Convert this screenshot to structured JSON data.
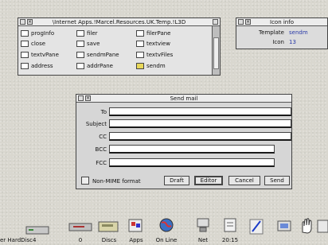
{
  "filer": {
    "title": "\\Internet Apps.!Marcel.Resources.UK.Temp.!L3D",
    "files": [
      {
        "name": "progInfo",
        "col": 0,
        "row": 0,
        "yellow": false
      },
      {
        "name": "close",
        "col": 0,
        "row": 1,
        "yellow": false
      },
      {
        "name": "textvPane",
        "col": 0,
        "row": 2,
        "yellow": false
      },
      {
        "name": "address",
        "col": 0,
        "row": 3,
        "yellow": false
      },
      {
        "name": "filer",
        "col": 1,
        "row": 0,
        "yellow": false
      },
      {
        "name": "save",
        "col": 1,
        "row": 1,
        "yellow": false
      },
      {
        "name": "sendmPane",
        "col": 1,
        "row": 2,
        "yellow": false
      },
      {
        "name": "addrPane",
        "col": 1,
        "row": 3,
        "yellow": false
      },
      {
        "name": "filerPane",
        "col": 2,
        "row": 0,
        "yellow": false
      },
      {
        "name": "textview",
        "col": 2,
        "row": 1,
        "yellow": false
      },
      {
        "name": "textvFiles",
        "col": 2,
        "row": 2,
        "yellow": false
      },
      {
        "name": "sendm",
        "col": 2,
        "row": 3,
        "yellow": true
      }
    ]
  },
  "icon_info": {
    "title": "Icon info",
    "template_label": "Template",
    "template_value": "sendm",
    "icon_label": "Icon",
    "icon_value": "13"
  },
  "send_mail": {
    "title": "Send mail",
    "fields": {
      "to": "To",
      "subject": "Subject",
      "cc": "CC",
      "bcc": "BCC",
      "fcc": "FCC"
    },
    "non_mime_label": "Non-MIME format",
    "buttons": {
      "draft": "Draft",
      "editor": "Editor",
      "cancel": "Cancel",
      "send": "Send"
    }
  },
  "iconbar": {
    "items": [
      {
        "label": "er HardDisc4"
      },
      {
        "label": "0"
      },
      {
        "label": "Discs"
      },
      {
        "label": "Apps"
      },
      {
        "label": "On Line"
      },
      {
        "label": "Net"
      },
      {
        "label": "20:15"
      }
    ]
  }
}
